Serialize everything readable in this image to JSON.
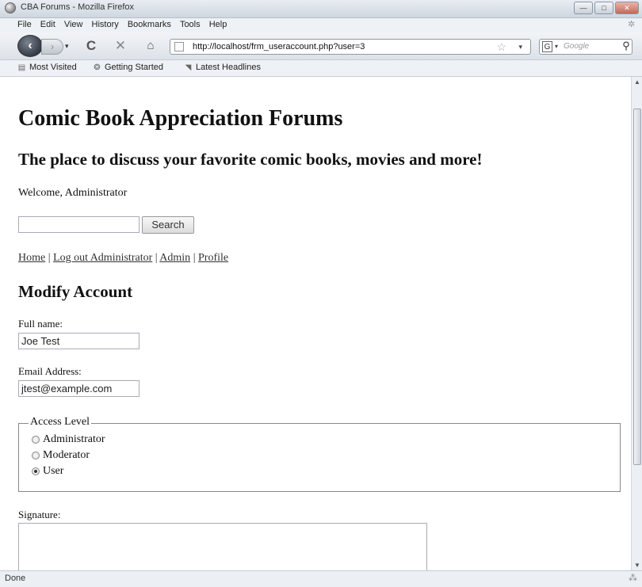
{
  "window": {
    "title": "CBA Forums - Mozilla Firefox",
    "controls": {
      "minimize": "—",
      "maximize": "□",
      "close": "✕"
    }
  },
  "menubar": [
    "File",
    "Edit",
    "View",
    "History",
    "Bookmarks",
    "Tools",
    "Help"
  ],
  "navigation": {
    "url": "http://localhost/frm_useraccount.php?user=3",
    "search_placeholder": "Google",
    "search_engine_icon": "G"
  },
  "bookmarks": [
    "Most Visited",
    "Getting Started",
    "Latest Headlines"
  ],
  "page": {
    "site_title": "Comic Book Appreciation Forums",
    "tagline": "The place to discuss your favorite comic books, movies and more!",
    "welcome": "Welcome, Administrator",
    "search_button": "Search",
    "search_value": "",
    "nav_links": [
      "Home",
      "Log out Administrator",
      "Admin",
      "Profile"
    ],
    "nav_separator": "|",
    "section_title": "Modify Account",
    "fullname_label": "Full name:",
    "fullname_value": "Joe Test",
    "email_label": "Email Address:",
    "email_value": "jtest@example.com",
    "access_legend": "Access Level",
    "access_levels": [
      {
        "label": "Administrator",
        "checked": false
      },
      {
        "label": "Moderator",
        "checked": false
      },
      {
        "label": "User",
        "checked": true
      }
    ],
    "signature_label": "Signature:",
    "signature_value": ""
  },
  "statusbar": {
    "status": "Done"
  },
  "icons": {
    "back": "back-arrow-icon",
    "forward": "forward-arrow-icon",
    "reload": "reload-icon",
    "stop": "stop-icon",
    "home": "home-icon",
    "bookmark_star": "star-icon",
    "search_go": "magnifier-icon"
  }
}
